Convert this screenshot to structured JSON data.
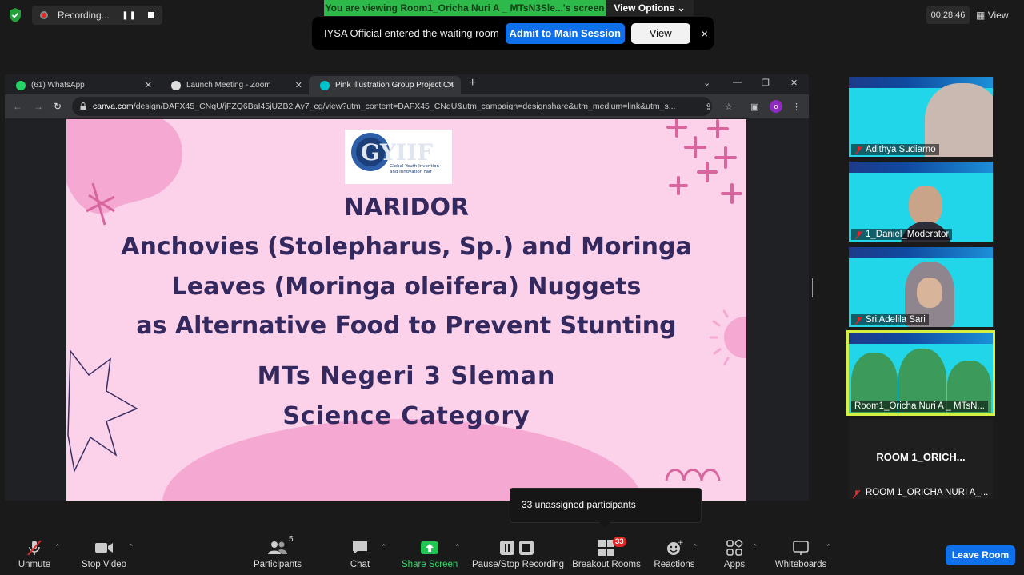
{
  "top": {
    "recording_label": "Recording...",
    "viewing_banner": "You are viewing Room1_Oricha Nuri A _ MTsN3Sle...'s screen",
    "view_options": "View Options",
    "timer": "00:28:46",
    "view_label": "View"
  },
  "notification": {
    "message": "IYSA Official entered the waiting room",
    "admit_label": "Admit to Main Session",
    "view_label": "View",
    "close": "×"
  },
  "browser": {
    "tabs": [
      {
        "label": "(61) WhatsApp",
        "color": "#25d366"
      },
      {
        "label": "Launch Meeting - Zoom",
        "color": "#dddddd"
      },
      {
        "label": "Pink Illustration Group Project Ch",
        "color": "#00c4cc"
      }
    ],
    "url_host": "canva.com",
    "url_path": "/design/DAFX45_CNqU/jFZQ6BaI45jUZB2lAy7_cg/view?utm_content=DAFX45_CNqU&utm_campaign=designshare&utm_medium=link&utm_s...",
    "profile_initial": "o"
  },
  "slide": {
    "logo_text": "GYIIF",
    "logo_sub": "Global Youth Invention and Innovation Fair",
    "line1": "NARIDOR",
    "line2": "Anchovies (Stolepharus, Sp.) and Moringa",
    "line3": "Leaves (Moringa oleifera) Nuggets",
    "line4": "as Alternative Food to Prevent Stunting",
    "line5": "MTs Negeri 3 Sleman",
    "line6": "Science Category"
  },
  "participants": [
    {
      "name": "Adithya Sudiarno"
    },
    {
      "name": "1_Daniel_Moderator"
    },
    {
      "name": "Sri Adelila Sari"
    },
    {
      "name": "Room1_Oricha Nuri A _ MTsN..."
    }
  ],
  "room_tile": {
    "title": "ROOM  1_ORICH...",
    "name": "ROOM 1_ORICHA NURI A_..."
  },
  "tooltip": "33 unassigned participants",
  "toolbar": {
    "unmute": "Unmute",
    "stop_video": "Stop Video",
    "participants": "Participants",
    "participants_count": "5",
    "chat": "Chat",
    "share_screen": "Share Screen",
    "record": "Pause/Stop Recording",
    "breakout": "Breakout Rooms",
    "breakout_badge": "33",
    "reactions": "Reactions",
    "apps": "Apps",
    "whiteboards": "Whiteboards",
    "leave": "Leave Room"
  },
  "colors": {
    "accent_blue": "#0e71eb",
    "banner_green": "#2dba4a",
    "slide_bg": "#fbd2ea",
    "slide_text": "#34295e",
    "active_border": "#d5ef42"
  }
}
